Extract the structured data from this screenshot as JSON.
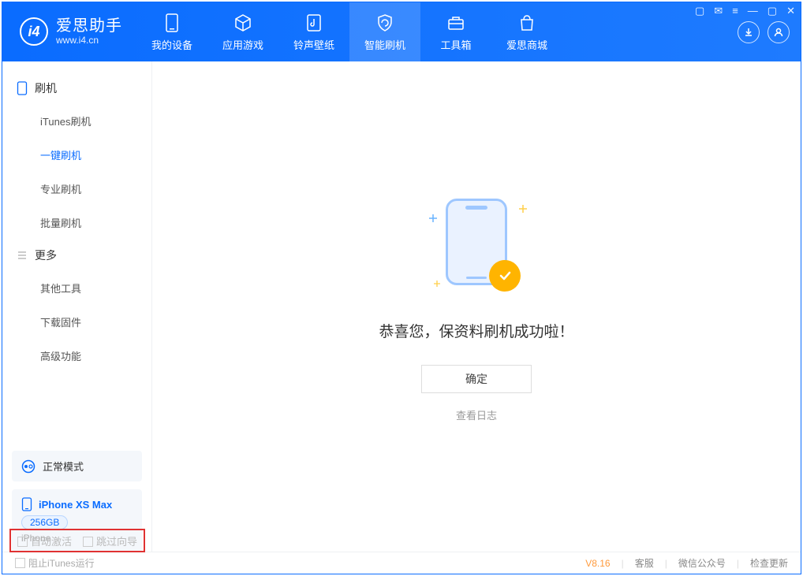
{
  "app": {
    "title": "爱思助手",
    "url": "www.i4.cn"
  },
  "nav": {
    "my_device": "我的设备",
    "apps_games": "应用游戏",
    "ring_wallpaper": "铃声壁纸",
    "smart_flash": "智能刷机",
    "toolbox": "工具箱",
    "store": "爱思商城"
  },
  "sidebar": {
    "group_flash": "刷机",
    "items_flash": [
      "iTunes刷机",
      "一键刷机",
      "专业刷机",
      "批量刷机"
    ],
    "group_more": "更多",
    "items_more": [
      "其他工具",
      "下载固件",
      "高级功能"
    ]
  },
  "mode": {
    "label": "正常模式"
  },
  "device": {
    "name": "iPhone XS Max",
    "capacity": "256GB",
    "type": "iPhone"
  },
  "main": {
    "success_text": "恭喜您，保资料刷机成功啦！",
    "confirm": "确定",
    "view_log": "查看日志"
  },
  "options": {
    "auto_activate": "自动激活",
    "skip_guide": "跳过向导"
  },
  "status": {
    "block_itunes": "阻止iTunes运行",
    "version": "V8.16",
    "support": "客服",
    "wechat": "微信公众号",
    "check_update": "检查更新"
  }
}
